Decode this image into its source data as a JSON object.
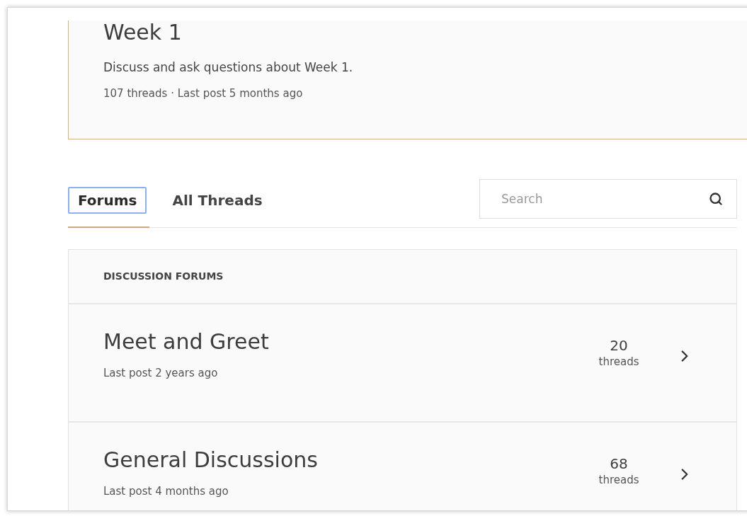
{
  "week_card": {
    "title": "Week 1",
    "description": "Discuss and ask questions about Week 1.",
    "meta": "107 threads · Last post 5 months ago"
  },
  "tabs": [
    {
      "label": "Forums",
      "selected": true
    },
    {
      "label": "All Threads",
      "selected": false
    }
  ],
  "search": {
    "placeholder": "Search"
  },
  "forums": {
    "heading": "DISCUSSION FORUMS",
    "items": [
      {
        "title": "Meet and Greet",
        "last_post": "Last post 2 years ago",
        "count": "20",
        "count_label": "threads"
      },
      {
        "title": "General Discussions",
        "last_post": "Last post 4 months ago",
        "count": "68",
        "count_label": "threads"
      }
    ]
  }
}
